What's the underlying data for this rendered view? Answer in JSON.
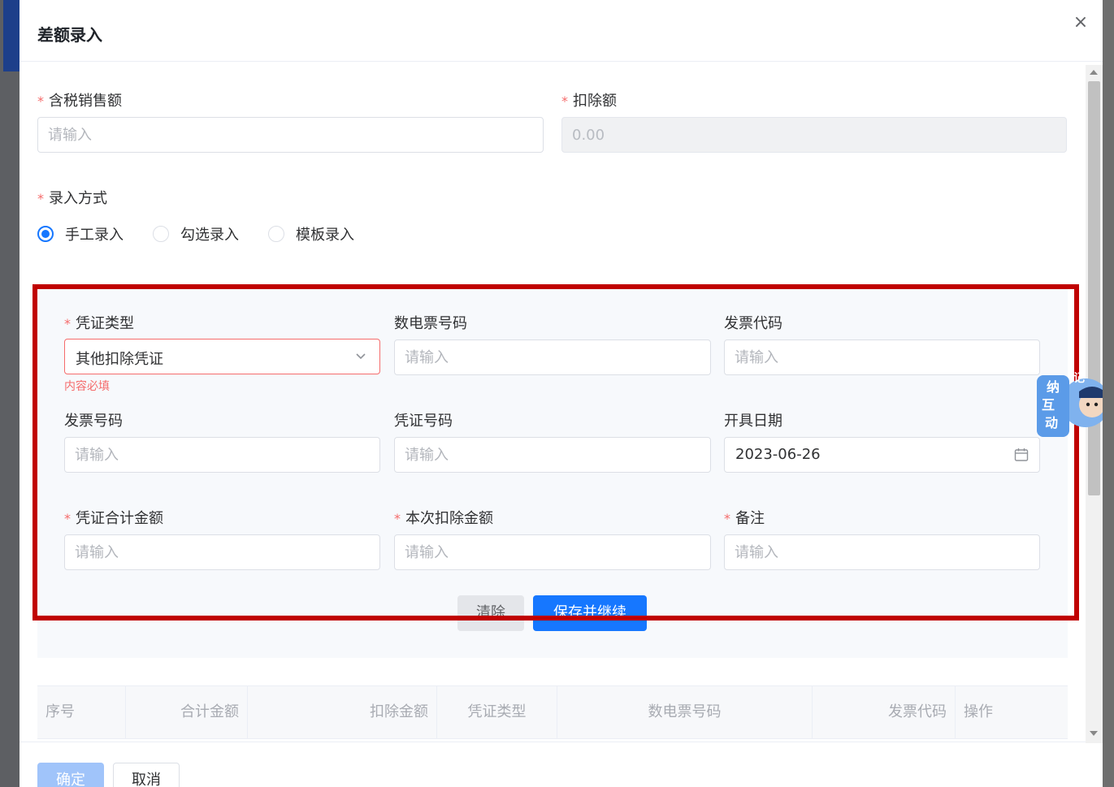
{
  "dialog": {
    "title": "差额录入",
    "close_label": "×"
  },
  "top_form": {
    "sales_label": "含税销售额",
    "sales_placeholder": "请输入",
    "deduct_label": "扣除额",
    "deduct_placeholder": "0.00",
    "mode_label": "录入方式",
    "modes": [
      {
        "label": "手工录入",
        "checked": true
      },
      {
        "label": "勾选录入",
        "checked": false
      },
      {
        "label": "模板录入",
        "checked": false
      }
    ]
  },
  "voucher_form": {
    "voucher_type_label": "凭证类型",
    "voucher_type_value": "其他扣除凭证",
    "voucher_type_error": "内容必填",
    "digital_invoice_no_label": "数电票号码",
    "invoice_code_label": "发票代码",
    "invoice_no_label": "发票号码",
    "voucher_no_label": "凭证号码",
    "issue_date_label": "开具日期",
    "issue_date_value": "2023-06-26",
    "voucher_total_label": "凭证合计金额",
    "deduct_amount_label": "本次扣除金额",
    "remark_label": "备注",
    "placeholder": "请输入",
    "clear_label": "清除",
    "save_continue_label": "保存并继续"
  },
  "table": {
    "columns": [
      "序号",
      "合计金额",
      "扣除金额",
      "凭证类型",
      "数电票号码",
      "发票代码",
      "操作"
    ]
  },
  "footer": {
    "confirm_label": "确定",
    "cancel_label": "取消"
  },
  "assistant": {
    "text_lines": [
      "纳",
      "互",
      "动",
      "记"
    ]
  },
  "colors": {
    "primary": "#1677ff",
    "required": "#f56c6c",
    "highlight": "#c00000"
  }
}
